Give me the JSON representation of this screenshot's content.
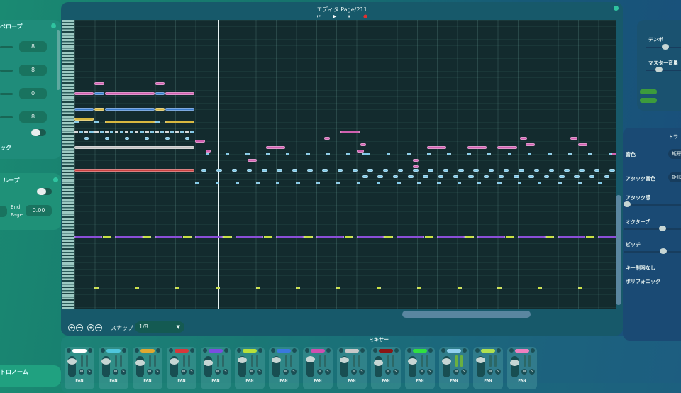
{
  "editor": {
    "title": "エディタ Page/211",
    "transport": [
      "⏮",
      "▶",
      "⏸",
      "●"
    ]
  },
  "left": {
    "envelope_title": "ベロープ",
    "values": [
      "8",
      "8",
      "0",
      "8"
    ],
    "arp_label": "ック",
    "loop_title": "ループ",
    "end_page_label_1": "End",
    "end_page_label_2": "Page",
    "end_page_value": "0.00",
    "metronome": "トロノーム"
  },
  "toolbar": {
    "snap_label": "スナップ",
    "snap_value": "1/8",
    "zoom": [
      "+",
      "−",
      "+",
      "−"
    ]
  },
  "mixer": {
    "title": "ミキサー",
    "pan": "PAN",
    "m": "M",
    "s": "S",
    "channels": [
      "#ffffff",
      "#4fc6dc",
      "#e0a830",
      "#d8373a",
      "#7a4de0",
      "#b8e03a",
      "#3a78e0",
      "#d04fb0",
      "#c8c8c8",
      "#8a1515",
      "#30e040",
      "#90d0f0",
      "#b0e050",
      "#f080c0"
    ]
  },
  "right": {
    "tempo": "テンポ",
    "master": "マスター音量",
    "track_title": "トラ",
    "tone": "音色",
    "tone_value": "矩形",
    "attack_tone": "アタック音色",
    "attack_tone_value": "矩形",
    "attack": "アタック感",
    "octave": "オクターブ",
    "pitch": "ピッチ",
    "no_key_limit": "キー制限なし",
    "polyphonic": "ポリフォニック"
  },
  "piano_roll": {
    "playhead_beat": 7.15,
    "colors": {
      "m": "#d060b0",
      "b": "#3a7ccc",
      "y": "#d8b840",
      "c": "#7cc8e8",
      "w": "#d8d8d8",
      "g": "#c0c0c0",
      "r": "#c84040",
      "p": "#8a4ed8",
      "l": "#c8e040"
    },
    "notes": [
      [
        20,
        1,
        0.5,
        "m"
      ],
      [
        20,
        4,
        0.5,
        "m"
      ],
      [
        23,
        0,
        1,
        "m"
      ],
      [
        23,
        1,
        0.5,
        "b"
      ],
      [
        23,
        1.5,
        2.5,
        "m"
      ],
      [
        23,
        4,
        0.5,
        "b"
      ],
      [
        23,
        4.5,
        1.5,
        "m"
      ],
      [
        28,
        0,
        1,
        "b"
      ],
      [
        28,
        1,
        0.5,
        "y"
      ],
      [
        28,
        1.5,
        2.5,
        "b"
      ],
      [
        28,
        4,
        0.5,
        "y"
      ],
      [
        28,
        4.5,
        1.5,
        "b"
      ],
      [
        31,
        0,
        1,
        "y"
      ],
      [
        32,
        0,
        0.25,
        "c"
      ],
      [
        32,
        1,
        0.25,
        "c"
      ],
      [
        32,
        1.5,
        2.5,
        "y"
      ],
      [
        32,
        4,
        0.25,
        "c"
      ],
      [
        32,
        4.5,
        1.5,
        "y"
      ],
      [
        40,
        0,
        6,
        "g"
      ],
      [
        47,
        0,
        6,
        "r"
      ],
      [
        38,
        6,
        0.5,
        "m"
      ],
      [
        41,
        6.5,
        0.3,
        "m"
      ],
      [
        35,
        13.2,
        1,
        "m"
      ],
      [
        40,
        9.5,
        1,
        "m"
      ],
      [
        42,
        14.3,
        0.3,
        "c"
      ],
      [
        40,
        17.5,
        1,
        "m"
      ],
      [
        40,
        19.5,
        1,
        "m"
      ],
      [
        40,
        21,
        1,
        "m"
      ],
      [
        44,
        8.6,
        0.5,
        "m"
      ],
      [
        44,
        16.8,
        0.3,
        "m"
      ],
      [
        41,
        14,
        0.4,
        "m"
      ],
      [
        37,
        12.4,
        0.3,
        "m"
      ],
      [
        39,
        14.2,
        0.3,
        "m"
      ],
      [
        46,
        16.8,
        0.3,
        "m"
      ],
      [
        37,
        22.1,
        0.4,
        "m"
      ],
      [
        39,
        22.4,
        0.5,
        "m"
      ],
      [
        37,
        24.6,
        0.4,
        "m"
      ],
      [
        39,
        25,
        0.5,
        "m"
      ],
      [
        42,
        26.6,
        0.4,
        "m"
      ]
    ],
    "patterns": [
      [
        35,
        0,
        0.25,
        24,
        0.22,
        "w"
      ],
      [
        37,
        0.5,
        1,
        6,
        0.25,
        "c"
      ],
      [
        42,
        6.5,
        1,
        21,
        0.22,
        "c"
      ],
      [
        47,
        6.3,
        0.75,
        28,
        0.3,
        "c"
      ],
      [
        49,
        14.3,
        0.75,
        18,
        0.3,
        "c"
      ],
      [
        51,
        6,
        1,
        21,
        0.22,
        "c"
      ],
      [
        68,
        0,
        2,
        14,
        1.4,
        "p"
      ],
      [
        68,
        1.4,
        2,
        14,
        0.45,
        "l"
      ],
      [
        84,
        1,
        2,
        13,
        0.25,
        "l"
      ]
    ]
  }
}
